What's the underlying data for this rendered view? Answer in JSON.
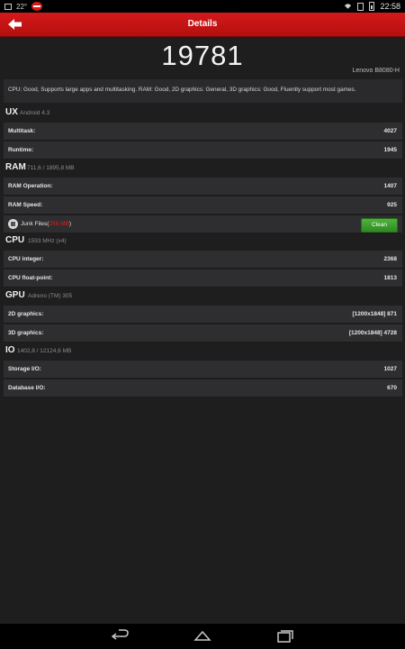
{
  "status_bar": {
    "temperature": "22°",
    "time": "22:58"
  },
  "app_bar": {
    "title": "Details"
  },
  "score": "19781",
  "device": "Lenovo B8080-H",
  "summary": "CPU: Good, Supports large apps and multitasking. RAM: Good, 2D graphics: General, 3D graphics: Good, Fluently support most games.",
  "sections": {
    "ux": {
      "name": "UX",
      "sub": "Android 4.3",
      "rows": [
        {
          "label": "Multitask:",
          "value": "4027"
        },
        {
          "label": "Runtime:",
          "value": "1945"
        }
      ]
    },
    "ram": {
      "name": "RAM",
      "sub": "711,6 / 1895,8 MB",
      "rows": [
        {
          "label": "RAM Operation:",
          "value": "1407"
        },
        {
          "label": "RAM Speed:",
          "value": "925"
        }
      ],
      "junk": {
        "label": "Junk Files(",
        "size": "256 MB",
        "close": ")",
        "button": "Clean"
      }
    },
    "cpu": {
      "name": "CPU",
      "sub": "1593 MHz (x4)",
      "rows": [
        {
          "label": "CPU integer:",
          "value": "2368"
        },
        {
          "label": "CPU float-point:",
          "value": "1813"
        }
      ]
    },
    "gpu": {
      "name": "GPU",
      "sub": "Adreno (TM) 305",
      "rows": [
        {
          "label": "2D graphics:",
          "value": "[1200x1848] 871"
        },
        {
          "label": "3D graphics:",
          "value": "[1200x1848] 4728"
        }
      ]
    },
    "io": {
      "name": "IO",
      "sub": "1402,8 / 12124,6 MB",
      "rows": [
        {
          "label": "Storage I/O:",
          "value": "1027"
        },
        {
          "label": "Database I/O:",
          "value": "670"
        }
      ]
    }
  },
  "colors": {
    "app_bar": "#c8161a",
    "clean_button": "#3e9d2d",
    "junk_size": "#e21c1c"
  }
}
